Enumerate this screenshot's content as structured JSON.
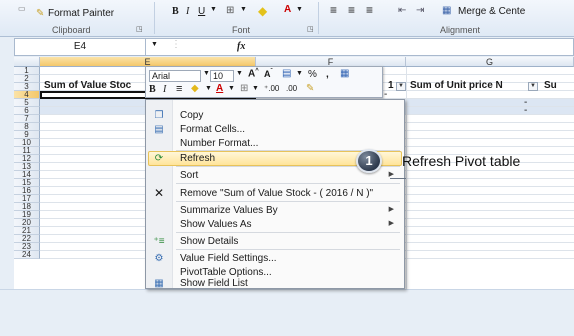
{
  "ribbon": {
    "format_painter": "Format Painter",
    "merge_center": "Merge & Cente",
    "groups": {
      "clipboard": "Clipboard",
      "font": "Font",
      "alignment": "Alignment"
    }
  },
  "formula_bar": {
    "name_box": "E4",
    "fx": "fx",
    "formula": ""
  },
  "columns": {
    "e": "E",
    "f": "F",
    "g": "G"
  },
  "rows": [
    "1",
    "2",
    "3",
    "4",
    "5",
    "6",
    "7",
    "8",
    "9",
    "10",
    "11",
    "12",
    "13",
    "14",
    "15",
    "16",
    "17",
    "18",
    "19",
    "20",
    "21",
    "22",
    "23",
    "24"
  ],
  "cells": {
    "e3": "Sum of Value Stoc",
    "f3_fragment": "1",
    "g3": "Sum of Unit price N",
    "h3": "Su",
    "dash": "-"
  },
  "mini_toolbar": {
    "font_name": "Arial",
    "font_size": "10",
    "bold": "B",
    "italic": "I",
    "percent": "%",
    "comma": ","
  },
  "context_menu": {
    "items": [
      {
        "label": "Copy"
      },
      {
        "label": "Format Cells..."
      },
      {
        "label": "Number Format..."
      },
      {
        "label": "Refresh"
      },
      {
        "label": "Sort"
      },
      {
        "label": "Remove \"Sum of Value Stock - ( 2016 / N )\""
      },
      {
        "label": "Summarize Values By"
      },
      {
        "label": "Show Values As"
      },
      {
        "label": "Show Details"
      },
      {
        "label": "Value Field Settings..."
      },
      {
        "label": "PivotTable Options..."
      },
      {
        "label": "Show Field List"
      }
    ],
    "highlighted": "Refresh"
  },
  "callout": {
    "number": "1",
    "text": "Refresh Pivot table"
  },
  "colors": {
    "highlight": "#ffe49a",
    "header": "#dde6f1",
    "callout": "#2e3a4d"
  }
}
